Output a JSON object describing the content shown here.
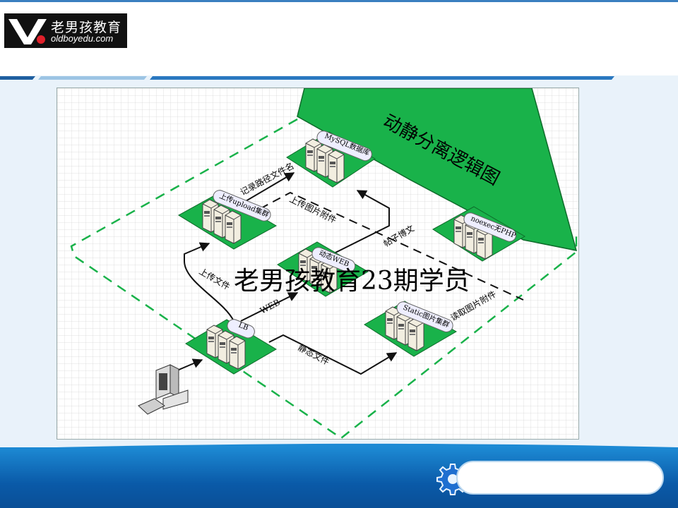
{
  "logo": {
    "cn": "老男孩教育",
    "en": "oldboyedu.com"
  },
  "diagram": {
    "title": "动静分离逻辑图",
    "watermark": "老男孩教育23期学员",
    "nodes": {
      "mysql": "MySQL数据库",
      "upload": "上传upload集群",
      "dynamic": "动态WEB",
      "noexec": "noexec无PHP",
      "static": "Static图片集群",
      "lb": "LB"
    },
    "edges": {
      "record_path": "记录路径文件名",
      "upload_attach": "上传图片附件",
      "post_article": "帖子博文",
      "upload_file": "上传文件",
      "web": "WEB",
      "read_attach": "读取图片附件",
      "static_file": "静态文件"
    }
  },
  "colors": {
    "green": "#19b24a",
    "dark_green": "#0e7a2e",
    "footer_blue": "#0a5aa8"
  },
  "icons": {
    "gear": "gear-icon"
  }
}
